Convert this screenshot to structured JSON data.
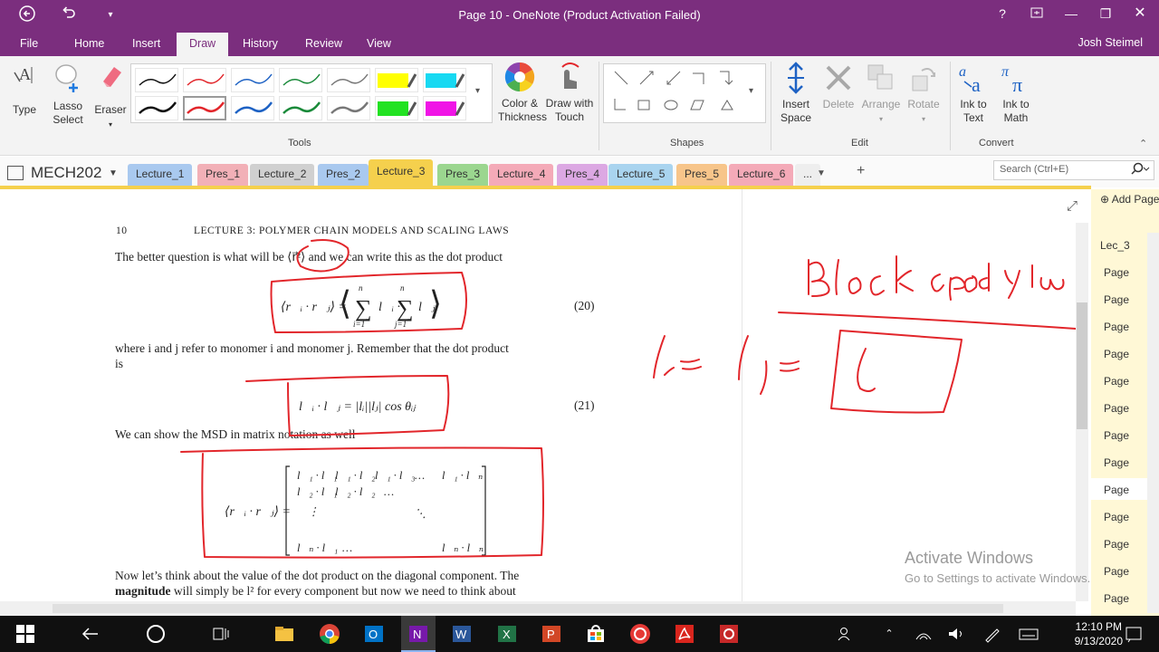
{
  "window": {
    "title": "Page 10 - OneNote (Product Activation Failed)"
  },
  "ribbon_tabs": [
    "File",
    "Home",
    "Insert",
    "Draw",
    "History",
    "Review",
    "View"
  ],
  "user": "Josh Steimel",
  "tools": {
    "type": "Type",
    "lasso": "Lasso",
    "lasso2": "Select",
    "eraser": "Eraser",
    "color": "Color &",
    "color2": "Thickness",
    "drawtouch": "Draw with",
    "drawtouch2": "Touch",
    "group": "Tools"
  },
  "shapes_group": "Shapes",
  "edit": {
    "insert": "Insert",
    "insert2": "Space",
    "delete": "Delete",
    "arrange": "Arrange",
    "rotate": "Rotate",
    "group": "Edit"
  },
  "convert": {
    "ink_text": "Ink to",
    "ink_text2": "Text",
    "ink_math": "Ink to",
    "ink_math2": "Math",
    "group": "Convert"
  },
  "notebook": "MECH202",
  "sections": [
    "Lecture_1",
    "Pres_1",
    "Lecture_2",
    "Pres_2",
    "Lecture_3",
    "Pres_3",
    "Lecture_4",
    "Pres_4",
    "Lecture_5",
    "Pres_5",
    "Lecture_6",
    "..."
  ],
  "search_placeholder": "Search (Ctrl+E)",
  "add_page": "Add Page",
  "pages": [
    "Lec_3",
    "Page",
    "Page",
    "Page",
    "Page",
    "Page",
    "Page",
    "Page",
    "Page",
    "Page",
    "Page",
    "Page",
    "Page",
    "Page"
  ],
  "doc": {
    "page_num": "10",
    "header": "LECTURE 3: POLYMER CHAIN MODELS AND SCALING LAWS",
    "p1": "The better question is what will be ⟨r⃗²⟩ and we can write this as the dot product",
    "eq20": "(20)",
    "p2": "where i and j refer to monomer i and monomer j. Remember that the dot product",
    "p2b": "is",
    "eq21": "(21)",
    "p3": "We can show the MSD in matrix notation as well",
    "p4": "Now let’s think about the value of the dot product on the diagonal component. The",
    "p5_bold": "magnitude",
    "p5_rest": " will simply be l² for every component but now we need to think about"
  },
  "watermark": {
    "line1": "Activate Windows",
    "line2": "Go to Settings to activate Windows."
  },
  "clock": {
    "time": "12:10 PM",
    "date": "9/13/2020"
  },
  "colors": {
    "accent": "#7b2e7e",
    "ink": "#e2262b",
    "section_active": "#f5d04d"
  }
}
